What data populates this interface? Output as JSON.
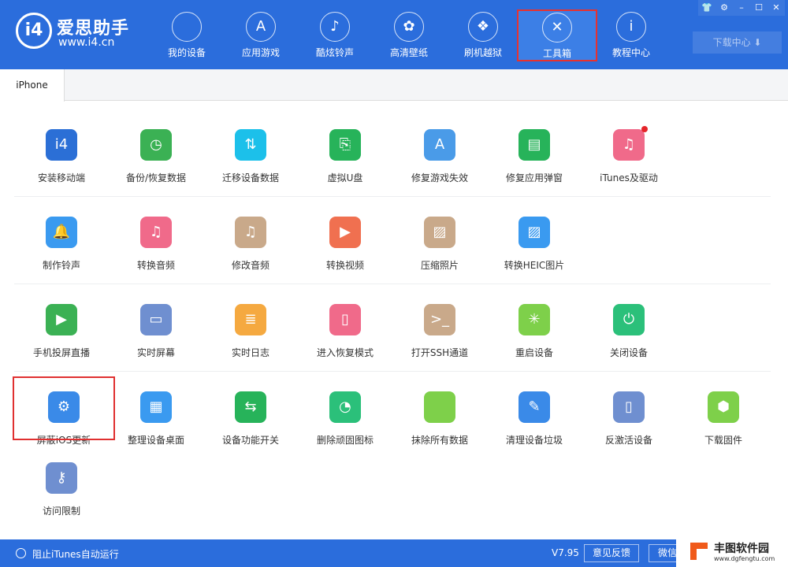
{
  "header": {
    "logo": {
      "mark": "i4",
      "name": "爱思助手",
      "url": "www.i4.cn"
    },
    "nav": [
      {
        "label": "我的设备",
        "icon": "apple-icon",
        "glyph": ""
      },
      {
        "label": "应用游戏",
        "icon": "app-store-icon",
        "glyph": "A"
      },
      {
        "label": "酷炫铃声",
        "icon": "bell-icon",
        "glyph": "♪"
      },
      {
        "label": "高清壁纸",
        "icon": "flower-icon",
        "glyph": "✿"
      },
      {
        "label": "刷机越狱",
        "icon": "box-icon",
        "glyph": "❖"
      },
      {
        "label": "工具箱",
        "icon": "tools-icon",
        "glyph": "✕",
        "active": true
      },
      {
        "label": "教程中心",
        "icon": "info-icon",
        "glyph": "i"
      }
    ],
    "window_buttons": [
      {
        "name": "skin-icon",
        "glyph": "👕"
      },
      {
        "name": "gear-icon",
        "glyph": "⚙"
      },
      {
        "name": "minimize-icon",
        "glyph": "–"
      },
      {
        "name": "maximize-icon",
        "glyph": "☐"
      },
      {
        "name": "close-icon",
        "glyph": "✕"
      }
    ],
    "download_center": "下载中心 ⬇"
  },
  "tabs": [
    {
      "label": "iPhone"
    }
  ],
  "tools": [
    [
      {
        "label": "安装移动端",
        "color": "#2b6fd6",
        "glyph": "i4"
      },
      {
        "label": "备份/恢复数据",
        "color": "#3bb154",
        "glyph": "◷"
      },
      {
        "label": "迁移设备数据",
        "color": "#1cc0ea",
        "glyph": "⇅"
      },
      {
        "label": "虚拟U盘",
        "color": "#27b35a",
        "glyph": "⎘"
      },
      {
        "label": "修复游戏失效",
        "color": "#4a9be8",
        "glyph": "A"
      },
      {
        "label": "修复应用弹窗",
        "color": "#27b35a",
        "glyph": "▤"
      },
      {
        "label": "iTunes及驱动",
        "color": "#f06a8a",
        "glyph": "♫",
        "badge": true
      }
    ],
    [
      {
        "label": "制作铃声",
        "color": "#3a9af0",
        "glyph": "🔔"
      },
      {
        "label": "转换音频",
        "color": "#f06a8a",
        "glyph": "♫"
      },
      {
        "label": "修改音频",
        "color": "#c9a98a",
        "glyph": "♫"
      },
      {
        "label": "转换视频",
        "color": "#f07050",
        "glyph": "▶"
      },
      {
        "label": "压缩照片",
        "color": "#c9a98a",
        "glyph": "▨"
      },
      {
        "label": "转换HEIC图片",
        "color": "#3a9af0",
        "glyph": "▨"
      }
    ],
    [
      {
        "label": "手机投屏直播",
        "color": "#3bb154",
        "glyph": "▶"
      },
      {
        "label": "实时屏幕",
        "color": "#6f8fd0",
        "glyph": "▭"
      },
      {
        "label": "实时日志",
        "color": "#f5a940",
        "glyph": "≣"
      },
      {
        "label": "进入恢复模式",
        "color": "#f06a8a",
        "glyph": "▯"
      },
      {
        "label": "打开SSH通道",
        "color": "#c9a98a",
        "glyph": ">_"
      },
      {
        "label": "重启设备",
        "color": "#7ed04a",
        "glyph": "✳"
      },
      {
        "label": "关闭设备",
        "color": "#2bc07a",
        "glyph": "⏻"
      }
    ],
    [
      {
        "label": "屏蔽iOS更新",
        "color": "#3a8ae8",
        "glyph": "⚙",
        "highlight": true
      },
      {
        "label": "整理设备桌面",
        "color": "#3a9af0",
        "glyph": "▦"
      },
      {
        "label": "设备功能开关",
        "color": "#27b35a",
        "glyph": "⇆"
      },
      {
        "label": "删除顽固图标",
        "color": "#2bc07a",
        "glyph": "◔"
      },
      {
        "label": "抹除所有数据",
        "color": "#7ed04a",
        "glyph": ""
      },
      {
        "label": "清理设备垃圾",
        "color": "#3a8ae8",
        "glyph": "✎"
      },
      {
        "label": "反激活设备",
        "color": "#6f8fd0",
        "glyph": "▯"
      },
      {
        "label": "下载固件",
        "color": "#7ed04a",
        "glyph": "⬢"
      }
    ],
    [
      {
        "label": "访问限制",
        "color": "#6f8fd0",
        "glyph": "⚷"
      }
    ]
  ],
  "status": {
    "itunes_toggle": "阻止iTunes自动运行",
    "version": "V7.95",
    "feedback": "意见反馈",
    "wechat": "微信公"
  },
  "watermark": {
    "name": "丰图软件园",
    "url": "www.dgfengtu.com"
  }
}
